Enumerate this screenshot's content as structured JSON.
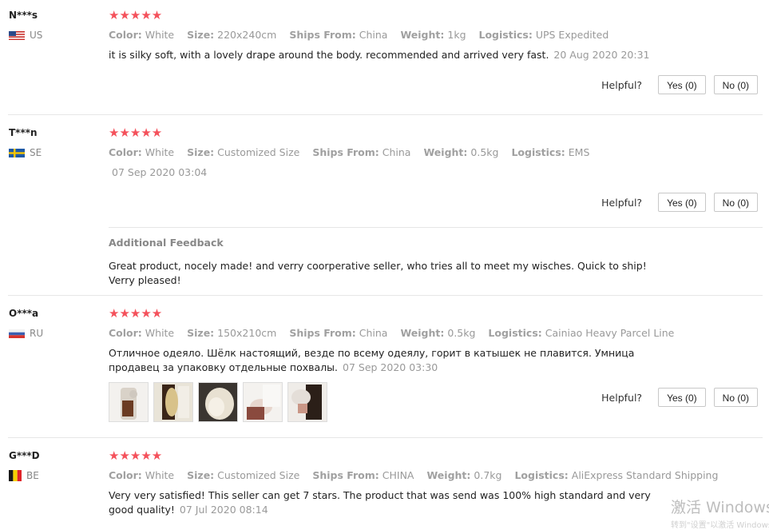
{
  "reviews": [
    {
      "user": "N***s",
      "country": "US",
      "stars": "★★★★★",
      "specs": [
        {
          "key": "Color:",
          "value": "White"
        },
        {
          "key": "Size:",
          "value": "220x240cm"
        },
        {
          "key": "Ships From:",
          "value": "China"
        },
        {
          "key": "Weight:",
          "value": "1kg"
        },
        {
          "key": "Logistics:",
          "value": "UPS Expedited"
        }
      ],
      "text": "it is silky soft, with a lovely drape around the body. recommended and arrived very fast.",
      "date": "20 Aug 2020 20:31",
      "helpful_label": "Helpful?",
      "yes": "Yes (0)",
      "no": "No (0)"
    },
    {
      "user": "T***n",
      "country": "SE",
      "stars": "★★★★★",
      "specs": [
        {
          "key": "Color:",
          "value": "White"
        },
        {
          "key": "Size:",
          "value": "Customized Size"
        },
        {
          "key": "Ships From:",
          "value": "China"
        },
        {
          "key": "Weight:",
          "value": "0.5kg"
        },
        {
          "key": "Logistics:",
          "value": "EMS"
        }
      ],
      "date": "07 Sep 2020 03:04",
      "helpful_label": "Helpful?",
      "yes": "Yes (0)",
      "no": "No (0)",
      "additional_title": "Additional Feedback",
      "additional_text": "Great product, nocely made! and verry coorperative seller, who tries all to meet my wisches. Quick to ship! Verry pleased!"
    },
    {
      "user": "O***a",
      "country": "RU",
      "stars": "★★★★★",
      "specs": [
        {
          "key": "Color:",
          "value": "White"
        },
        {
          "key": "Size:",
          "value": "150x210cm"
        },
        {
          "key": "Ships From:",
          "value": "China"
        },
        {
          "key": "Weight:",
          "value": "0.5kg"
        },
        {
          "key": "Logistics:",
          "value": "Cainiao Heavy Parcel Line"
        }
      ],
      "text": "Отличное одеяло. Шёлк настоящий, везде по всему одеялу, горит в катышек не плавится. Умница продавец за упаковку отдельные похвалы.",
      "date": "07 Sep 2020 03:30",
      "helpful_label": "Helpful?",
      "yes": "Yes (0)",
      "no": "No (0)"
    },
    {
      "user": "G***D",
      "country": "BE",
      "stars": "★★★★★",
      "specs": [
        {
          "key": "Color:",
          "value": "White"
        },
        {
          "key": "Size:",
          "value": "Customized Size"
        },
        {
          "key": "Ships From:",
          "value": "CHINA"
        },
        {
          "key": "Weight:",
          "value": "0.7kg"
        },
        {
          "key": "Logistics:",
          "value": "AliExpress Standard Shipping"
        }
      ],
      "text": "Very very satisfied! This seller can get 7 stars. The product that was send was 100% high standard and very good quality!",
      "date": "07 Jul 2020 08:14"
    }
  ],
  "watermark": "激活 Windows",
  "watermark_sub": "转到\"设置\"以激活 Windows",
  "colors": {
    "star": "#f4515b",
    "muted": "#999999",
    "border": "#e6e6e6"
  }
}
